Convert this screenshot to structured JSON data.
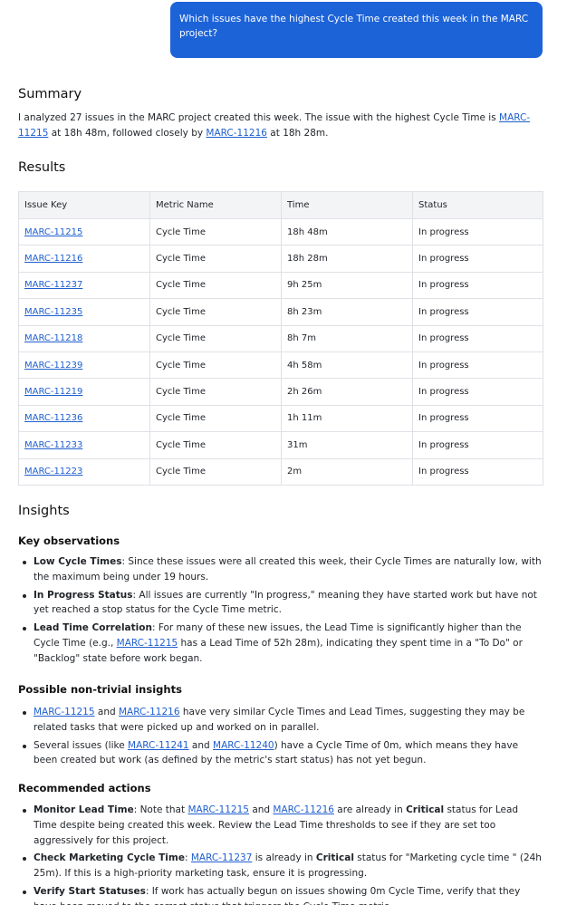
{
  "chat": {
    "question": "Which issues have the highest Cycle Time created this week in the MARC project?"
  },
  "summary": {
    "title": "Summary",
    "text_1": "I analyzed 27 issues in the MARC project created this week. The issue with the highest Cycle Time is ",
    "link_1": "MARC-11215",
    "text_2": " at 18h 48m, followed closely by ",
    "link_2": "MARC-11216",
    "text_3": " at 18h 28m."
  },
  "results": {
    "title": "Results",
    "headers": [
      "Issue Key",
      "Metric Name",
      "Time",
      "Status"
    ],
    "rows": [
      {
        "key": "MARC-11215",
        "metric": "Cycle Time",
        "time": "18h 48m",
        "status": "In progress"
      },
      {
        "key": "MARC-11216",
        "metric": "Cycle Time",
        "time": "18h 28m",
        "status": "In progress"
      },
      {
        "key": "MARC-11237",
        "metric": "Cycle Time",
        "time": "9h 25m",
        "status": "In progress"
      },
      {
        "key": "MARC-11235",
        "metric": "Cycle Time",
        "time": "8h 23m",
        "status": "In progress"
      },
      {
        "key": "MARC-11218",
        "metric": "Cycle Time",
        "time": "8h 7m",
        "status": "In progress"
      },
      {
        "key": "MARC-11239",
        "metric": "Cycle Time",
        "time": "4h 58m",
        "status": "In progress"
      },
      {
        "key": "MARC-11219",
        "metric": "Cycle Time",
        "time": "2h 26m",
        "status": "In progress"
      },
      {
        "key": "MARC-11236",
        "metric": "Cycle Time",
        "time": "1h 11m",
        "status": "In progress"
      },
      {
        "key": "MARC-11233",
        "metric": "Cycle Time",
        "time": "31m",
        "status": "In progress"
      },
      {
        "key": "MARC-11223",
        "metric": "Cycle Time",
        "time": "2m",
        "status": "In progress"
      }
    ]
  },
  "insights": {
    "title": "Insights",
    "key_observations": {
      "title": "Key observations",
      "item1_bold": "Low Cycle Times",
      "item1_text": ": Since these issues were all created this week, their Cycle Times are naturally low, with the maximum being under 19 hours.",
      "item2_bold": "In Progress Status",
      "item2_text": ": All issues are currently \"In progress,\" meaning they have started work but have not yet reached a stop status for the Cycle Time metric.",
      "item3_bold": "Lead Time Correlation",
      "item3_text_a": ": For many of these new issues, the Lead Time is significantly higher than the Cycle Time (e.g., ",
      "item3_link": "MARC-11215",
      "item3_text_b": " has a Lead Time of 52h 28m), indicating they spent time in a \"To Do\" or \"Backlog\" state before work began."
    },
    "non_trivial": {
      "title": "Possible non-trivial insights",
      "item1_link_a": "MARC-11215",
      "item1_mid": " and ",
      "item1_link_b": "MARC-11216",
      "item1_text": " have very similar Cycle Times and Lead Times, suggesting they may be related tasks that were picked up and worked on in parallel.",
      "item2_text_a": "Several issues (like ",
      "item2_link_a": "MARC-11241",
      "item2_mid": " and ",
      "item2_link_b": "MARC-11240",
      "item2_text_b": ") have a Cycle Time of 0m, which means they have been created but work (as defined by the metric's start status) has not yet begun."
    },
    "actions": {
      "title": "Recommended actions",
      "item1_bold": "Monitor Lead Time",
      "item1_text_a": ": Note that ",
      "item1_link_a": "MARC-11215",
      "item1_mid": " and ",
      "item1_link_b": "MARC-11216",
      "item1_text_b": " are already in ",
      "item1_bold_2": "Critical",
      "item1_text_c": " status for Lead Time despite being created this week. Review the Lead Time thresholds to see if they are set too aggressively for this project.",
      "item2_bold": "Check Marketing Cycle Time",
      "item2_text_a": ": ",
      "item2_link": "MARC-11237",
      "item2_text_b": " is already in ",
      "item2_bold_2": "Critical",
      "item2_text_c": " status for \"Marketing cycle time \" (24h 25m). If this is a high-priority marketing task, ensure it is progressing.",
      "item3_bold": "Verify Start Statuses",
      "item3_text": ": If work has actually begun on issues showing 0m Cycle Time, verify that they have been moved to the correct status that triggers the Cycle Time metric."
    }
  }
}
